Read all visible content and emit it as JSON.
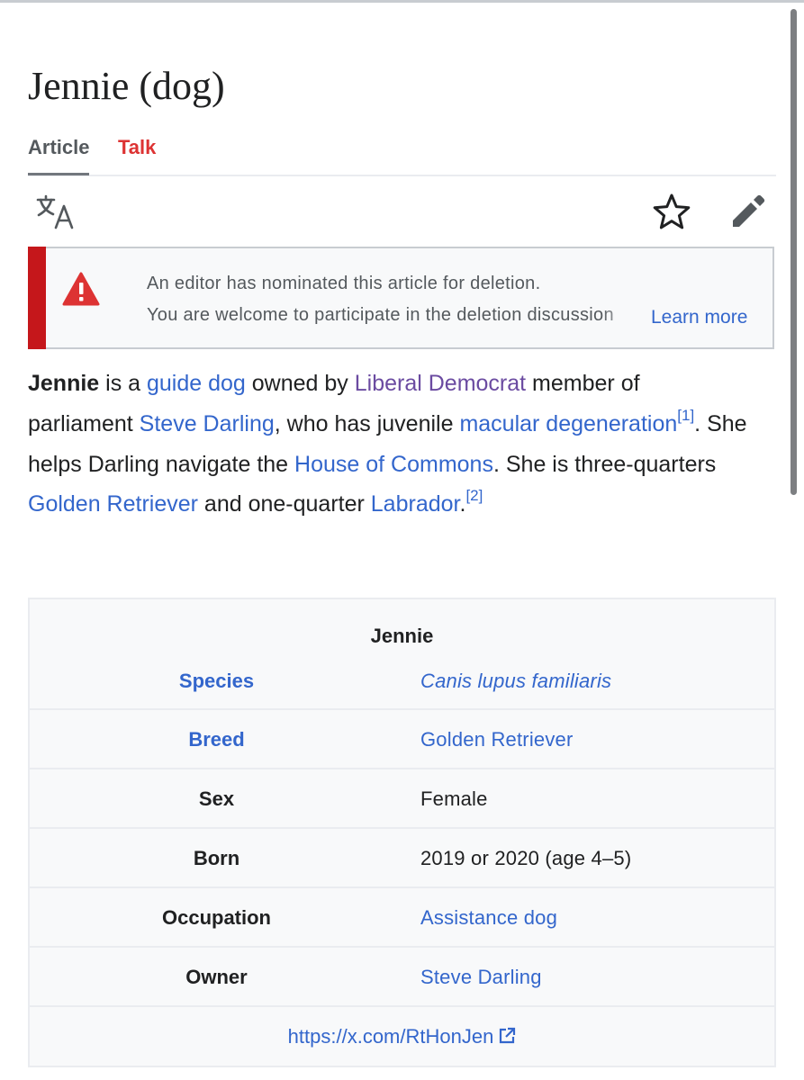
{
  "page": {
    "title": "Jennie (dog)",
    "tabs": [
      {
        "label": "Article",
        "active": true
      },
      {
        "label": "Talk",
        "active": false
      }
    ],
    "icons": {
      "language": "translate-icon",
      "watch": "star-icon",
      "edit": "pencil-icon"
    }
  },
  "notice": {
    "icon": "warning-icon",
    "line1": "An editor has nominated this article for deletion.",
    "line2": "You are welcome to participate in the deletion discussion",
    "learn_more": "Learn more",
    "accent_color": "#c5171b"
  },
  "lead": {
    "subject": "Jennie",
    "t1": " is a ",
    "l_guide_dog": "guide dog",
    "t2": " owned by ",
    "l_lib_dem": "Liberal Democrat",
    "t3": " member of parliament ",
    "l_steve": "Steve Darling",
    "t4": ", who has juvenile ",
    "l_macular": "macular degeneration",
    "ref1": "[1]",
    "t5": ". She helps Darling navigate the ",
    "l_house": "House of Commons",
    "t6": ". She is three-quarters ",
    "l_golden": "Golden Retriever",
    "t7": " and one-quarter ",
    "l_labrador": "Labrador",
    "t8": ".",
    "ref2": "[2]"
  },
  "infobox": {
    "caption": "Jennie",
    "rows": [
      {
        "label": "Species",
        "value": "Canis lupus familiaris"
      },
      {
        "label": "Breed",
        "value": "Golden Retriever"
      },
      {
        "label": "Sex",
        "value": "Female"
      },
      {
        "label": "Born",
        "value": "2019 or 2020 (age 4–5)"
      },
      {
        "label": "Occupation",
        "value": "Assistance dog"
      },
      {
        "label": "Owner",
        "value": "Steve Darling"
      }
    ],
    "website": "https://x.com/RtHonJen",
    "website_icon": "external-link-icon"
  },
  "colors": {
    "link": "#3366cc",
    "visited_link": "#6b4ba1",
    "talk_tab": "#dd3333",
    "text": "#202122"
  }
}
